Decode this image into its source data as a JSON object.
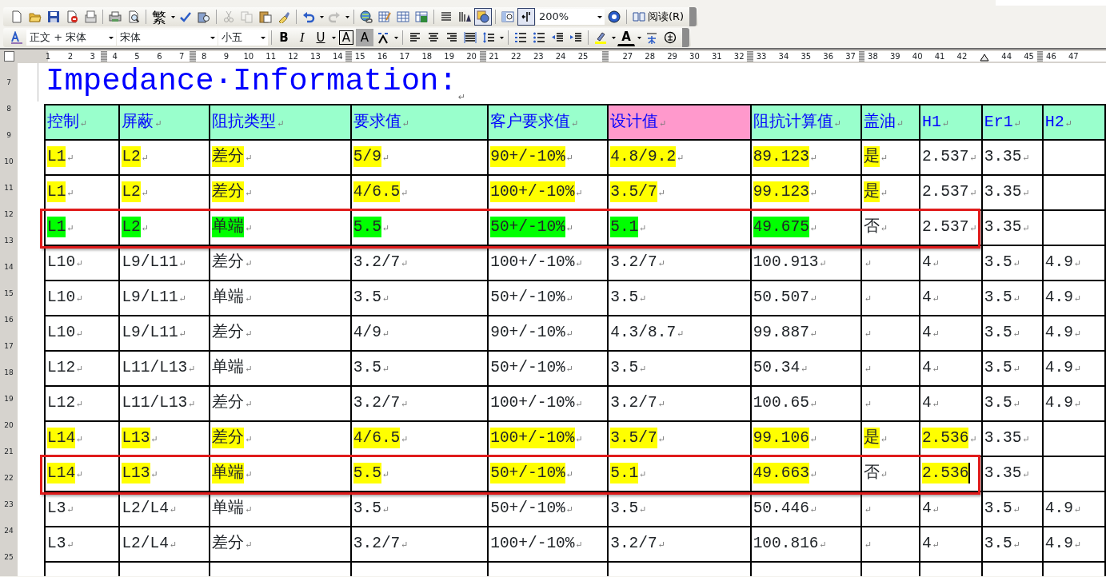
{
  "toolbar_standard": [
    {
      "kind": "icon"
    },
    {
      "kind": "icon"
    },
    {
      "kind": "icon"
    },
    {
      "kind": "icon"
    },
    {
      "kind": "icon"
    },
    {
      "kind": "sep"
    },
    {
      "kind": "icon"
    },
    {
      "kind": "icon"
    },
    {
      "kind": "sep"
    },
    {
      "kind": "text",
      "label": "繁"
    },
    {
      "kind": "drop"
    },
    {
      "kind": "icon"
    },
    {
      "kind": "icon"
    },
    {
      "kind": "sep"
    },
    {
      "kind": "icon",
      "disabled": true
    },
    {
      "kind": "icon",
      "disabled": true
    },
    {
      "kind": "icon"
    },
    {
      "kind": "icon"
    },
    {
      "kind": "sep"
    },
    {
      "kind": "icon"
    },
    {
      "kind": "drop"
    },
    {
      "kind": "icon",
      "disabled": true
    },
    {
      "kind": "drop"
    },
    {
      "kind": "sep"
    },
    {
      "kind": "icon"
    },
    {
      "kind": "icon"
    },
    {
      "kind": "icon"
    },
    {
      "kind": "icon"
    },
    {
      "kind": "sep"
    },
    {
      "kind": "icon"
    },
    {
      "kind": "icon"
    },
    {
      "kind": "icon",
      "pressed": true
    },
    {
      "kind": "sep"
    },
    {
      "kind": "icon"
    },
    {
      "kind": "icon",
      "pressed": true
    },
    {
      "kind": "combo",
      "value": "200%"
    },
    {
      "kind": "icon"
    },
    {
      "kind": "sep"
    },
    {
      "kind": "labeled",
      "label": "阅读(R)"
    }
  ],
  "toolbar_formatting": [
    {
      "kind": "icon"
    },
    {
      "kind": "combo",
      "value": "正文 + 宋体"
    },
    {
      "kind": "combo",
      "value": "宋体"
    },
    {
      "kind": "combo",
      "value": "小五"
    },
    {
      "kind": "sep"
    },
    {
      "kind": "bold",
      "label": "B"
    },
    {
      "kind": "italic",
      "label": "I"
    },
    {
      "kind": "underline",
      "label": "U"
    },
    {
      "kind": "drop"
    },
    {
      "kind": "boxed",
      "label": "A"
    },
    {
      "kind": "shaded",
      "label": "A"
    },
    {
      "kind": "icon"
    },
    {
      "kind": "drop"
    },
    {
      "kind": "sep"
    },
    {
      "kind": "icon"
    },
    {
      "kind": "icon"
    },
    {
      "kind": "icon"
    },
    {
      "kind": "icon"
    },
    {
      "kind": "icon"
    },
    {
      "kind": "drop"
    },
    {
      "kind": "sep"
    },
    {
      "kind": "icon"
    },
    {
      "kind": "icon"
    },
    {
      "kind": "icon"
    },
    {
      "kind": "icon"
    },
    {
      "kind": "sep"
    },
    {
      "kind": "icon"
    },
    {
      "kind": "drop"
    },
    {
      "kind": "fontcolor",
      "label": "A"
    },
    {
      "kind": "drop"
    },
    {
      "kind": "icon"
    },
    {
      "kind": "icon"
    }
  ],
  "ruler": [
    {
      "kind": "number",
      "label": "1"
    },
    {
      "kind": "number",
      "label": "2"
    },
    {
      "kind": "number",
      "label": "3"
    },
    {
      "kind": "grip"
    },
    {
      "kind": "number",
      "label": "4"
    },
    {
      "kind": "number",
      "label": "5"
    },
    {
      "kind": "number",
      "label": "6"
    },
    {
      "kind": "number",
      "label": "7"
    },
    {
      "kind": "grip"
    },
    {
      "kind": "number",
      "label": "8"
    },
    {
      "kind": "number",
      "label": "9"
    },
    {
      "kind": "number",
      "label": "10"
    },
    {
      "kind": "number",
      "label": "11"
    },
    {
      "kind": "number",
      "label": "12"
    },
    {
      "kind": "number",
      "label": "13"
    },
    {
      "kind": "number",
      "label": "14"
    },
    {
      "kind": "grip"
    },
    {
      "kind": "number",
      "label": "15"
    },
    {
      "kind": "number",
      "label": "16"
    },
    {
      "kind": "number",
      "label": "17"
    },
    {
      "kind": "number",
      "label": "18"
    },
    {
      "kind": "number",
      "label": "19"
    },
    {
      "kind": "number",
      "label": "20"
    },
    {
      "kind": "grip"
    },
    {
      "kind": "number",
      "label": "21"
    },
    {
      "kind": "number",
      "label": "22"
    },
    {
      "kind": "number",
      "label": "23"
    },
    {
      "kind": "number",
      "label": "24"
    },
    {
      "kind": "number",
      "label": "25"
    },
    {
      "kind": "grip-slot"
    },
    {
      "kind": "number",
      "label": "27"
    },
    {
      "kind": "number",
      "label": "28"
    },
    {
      "kind": "number",
      "label": "29"
    },
    {
      "kind": "number",
      "label": "30"
    },
    {
      "kind": "number",
      "label": "31"
    },
    {
      "kind": "number",
      "label": "32"
    },
    {
      "kind": "grip"
    },
    {
      "kind": "number",
      "label": "33"
    },
    {
      "kind": "number",
      "label": "34"
    },
    {
      "kind": "number",
      "label": "35"
    },
    {
      "kind": "number",
      "label": "36"
    },
    {
      "kind": "number",
      "label": "37"
    },
    {
      "kind": "grip"
    },
    {
      "kind": "number",
      "label": "38"
    },
    {
      "kind": "number",
      "label": "39"
    },
    {
      "kind": "number",
      "label": "40"
    },
    {
      "kind": "number",
      "label": "41"
    },
    {
      "kind": "number",
      "label": "42"
    },
    {
      "kind": "indent-slot"
    },
    {
      "kind": "number",
      "label": "44"
    },
    {
      "kind": "number",
      "label": "45"
    },
    {
      "kind": "grip"
    },
    {
      "kind": "number",
      "label": "46"
    },
    {
      "kind": "number",
      "label": "47"
    }
  ],
  "vertical_ruler": [
    "7",
    "8",
    "9",
    "10",
    "11",
    "12",
    "13",
    "14",
    "15",
    "16",
    "17",
    "18",
    "19",
    "20",
    "21",
    "22",
    "23",
    "24",
    "25"
  ],
  "paragraph_mark": "↵",
  "title": "Impedance·Information:",
  "table": {
    "columns": [
      {
        "text": "控制",
        "color": "#99ffcc"
      },
      {
        "text": "屏蔽",
        "color": "#99ffcc"
      },
      {
        "text": "阻抗类型",
        "color": "#99ffcc"
      },
      {
        "text": "要求值",
        "color": "#99ffcc"
      },
      {
        "text": "客户要求值",
        "color": "#99ffcc"
      },
      {
        "text": "设计值",
        "color": "#ff99cc"
      },
      {
        "text": "阻抗计算值",
        "color": "#99ffcc"
      },
      {
        "text": "盖油",
        "color": "#99ffcc"
      },
      {
        "text": "H1",
        "color": "#99ffcc"
      },
      {
        "text": "Er1",
        "color": "#99ffcc"
      },
      {
        "text": "H2",
        "color": "#99ffcc"
      }
    ],
    "rows": [
      {
        "outlined": false,
        "cells": [
          {
            "text": "L1",
            "color": "#ffff00"
          },
          {
            "text": "L2",
            "color": "#ffff00"
          },
          {
            "text": "差分",
            "color": "#ffff00"
          },
          {
            "text": "5/9",
            "color": "#ffff00"
          },
          {
            "text": "90+/-10%",
            "color": "#ffff00"
          },
          {
            "text": "4.8/9.2",
            "color": "#ffff00"
          },
          {
            "text": "89.123",
            "color": "#ffff00"
          },
          {
            "text": "是",
            "color": "#ffff00"
          },
          {
            "text": "2.537"
          },
          {
            "text": "3.35"
          },
          {}
        ]
      },
      {
        "outlined": false,
        "cells": [
          {
            "text": "L1",
            "color": "#ffff00"
          },
          {
            "text": "L2",
            "color": "#ffff00"
          },
          {
            "text": "差分",
            "color": "#ffff00"
          },
          {
            "text": "4/6.5",
            "color": "#ffff00"
          },
          {
            "text": "100+/-10%",
            "color": "#ffff00"
          },
          {
            "text": "3.5/7",
            "color": "#ffff00"
          },
          {
            "text": "99.123",
            "color": "#ffff00"
          },
          {
            "text": "是",
            "color": "#ffff00"
          },
          {
            "text": "2.537"
          },
          {
            "text": "3.35"
          },
          {}
        ]
      },
      {
        "outlined": true,
        "cells": [
          {
            "text": "L1",
            "color": "#00ff00"
          },
          {
            "text": "L2",
            "color": "#00ff00"
          },
          {
            "text": "单端",
            "color": "#00ff00"
          },
          {
            "text": "5.5",
            "color": "#00ff00"
          },
          {
            "text": "50+/-10%",
            "color": "#00ff00"
          },
          {
            "text": "5.1",
            "color": "#00ff00"
          },
          {
            "text": "49.675",
            "color": "#00ff00"
          },
          {
            "text": "否"
          },
          {
            "text": "2.537"
          },
          {
            "text": "3.35"
          },
          {}
        ]
      },
      {
        "outlined": false,
        "cells": [
          {
            "text": "L10"
          },
          {
            "text": "L9/L11"
          },
          {
            "text": "差分"
          },
          {
            "text": "3.2/7"
          },
          {
            "text": "100+/-10%"
          },
          {
            "text": "3.2/7"
          },
          {
            "text": "100.913"
          },
          {},
          {
            "text": "4"
          },
          {
            "text": "3.5"
          },
          {
            "text": "4.9"
          }
        ]
      },
      {
        "outlined": false,
        "cells": [
          {
            "text": "L10"
          },
          {
            "text": "L9/L11"
          },
          {
            "text": "单端"
          },
          {
            "text": "3.5"
          },
          {
            "text": "50+/-10%"
          },
          {
            "text": "3.5"
          },
          {
            "text": "50.507"
          },
          {},
          {
            "text": "4"
          },
          {
            "text": "3.5"
          },
          {
            "text": "4.9"
          }
        ]
      },
      {
        "outlined": false,
        "cells": [
          {
            "text": "L10"
          },
          {
            "text": "L9/L11"
          },
          {
            "text": "差分"
          },
          {
            "text": "4/9"
          },
          {
            "text": "90+/-10%"
          },
          {
            "text": "4.3/8.7"
          },
          {
            "text": "99.887"
          },
          {},
          {
            "text": "4"
          },
          {
            "text": "3.5"
          },
          {
            "text": "4.9"
          }
        ]
      },
      {
        "outlined": false,
        "cells": [
          {
            "text": "L12"
          },
          {
            "text": "L11/L13"
          },
          {
            "text": "单端"
          },
          {
            "text": "3.5"
          },
          {
            "text": "50+/-10%"
          },
          {
            "text": "3.5"
          },
          {
            "text": "50.34"
          },
          {},
          {
            "text": "4"
          },
          {
            "text": "3.5"
          },
          {
            "text": "4.9"
          }
        ]
      },
      {
        "outlined": false,
        "cells": [
          {
            "text": "L12"
          },
          {
            "text": "L11/L13"
          },
          {
            "text": "差分"
          },
          {
            "text": "3.2/7"
          },
          {
            "text": "100+/-10%"
          },
          {
            "text": "3.2/7"
          },
          {
            "text": "100.65"
          },
          {},
          {
            "text": "4"
          },
          {
            "text": "3.5"
          },
          {
            "text": "4.9"
          }
        ]
      },
      {
        "outlined": false,
        "cells": [
          {
            "text": "L14",
            "color": "#ffff00"
          },
          {
            "text": "L13",
            "color": "#ffff00"
          },
          {
            "text": "差分",
            "color": "#ffff00"
          },
          {
            "text": "4/6.5",
            "color": "#ffff00"
          },
          {
            "text": "100+/-10%",
            "color": "#ffff00"
          },
          {
            "text": "3.5/7",
            "color": "#ffff00"
          },
          {
            "text": "99.106",
            "color": "#ffff00"
          },
          {
            "text": "是",
            "color": "#ffff00"
          },
          {
            "text": "2.536",
            "color": "#ffff00"
          },
          {
            "text": "3.35"
          },
          {}
        ]
      },
      {
        "outlined": true,
        "cells": [
          {
            "text": "L14",
            "color": "#ffff00"
          },
          {
            "text": "L13",
            "color": "#ffff00"
          },
          {
            "text": "单端",
            "color": "#ffff00"
          },
          {
            "text": "5.5",
            "color": "#ffff00"
          },
          {
            "text": "50+/-10%",
            "color": "#ffff00"
          },
          {
            "text": "5.1",
            "color": "#ffff00"
          },
          {
            "text": "49.663",
            "color": "#ffff00"
          },
          {
            "text": "否"
          },
          {
            "text": "2.536",
            "color": "#ffff00",
            "cursor": true
          },
          {
            "text": "3.35"
          },
          {}
        ]
      },
      {
        "outlined": false,
        "cells": [
          {
            "text": "L3"
          },
          {
            "text": "L2/L4"
          },
          {
            "text": "单端"
          },
          {
            "text": "3.5"
          },
          {
            "text": "50+/-10%"
          },
          {
            "text": "3.5"
          },
          {
            "text": "50.446"
          },
          {},
          {
            "text": "4"
          },
          {
            "text": "3.5"
          },
          {
            "text": "4.9"
          }
        ]
      },
      {
        "outlined": false,
        "cells": [
          {
            "text": "L3"
          },
          {
            "text": "L2/L4"
          },
          {
            "text": "差分"
          },
          {
            "text": "3.2/7"
          },
          {
            "text": "100+/-10%"
          },
          {
            "text": "3.2/7"
          },
          {
            "text": "100.816"
          },
          {},
          {
            "text": "4"
          },
          {
            "text": "3.5"
          },
          {
            "text": "4.9"
          }
        ]
      }
    ]
  }
}
